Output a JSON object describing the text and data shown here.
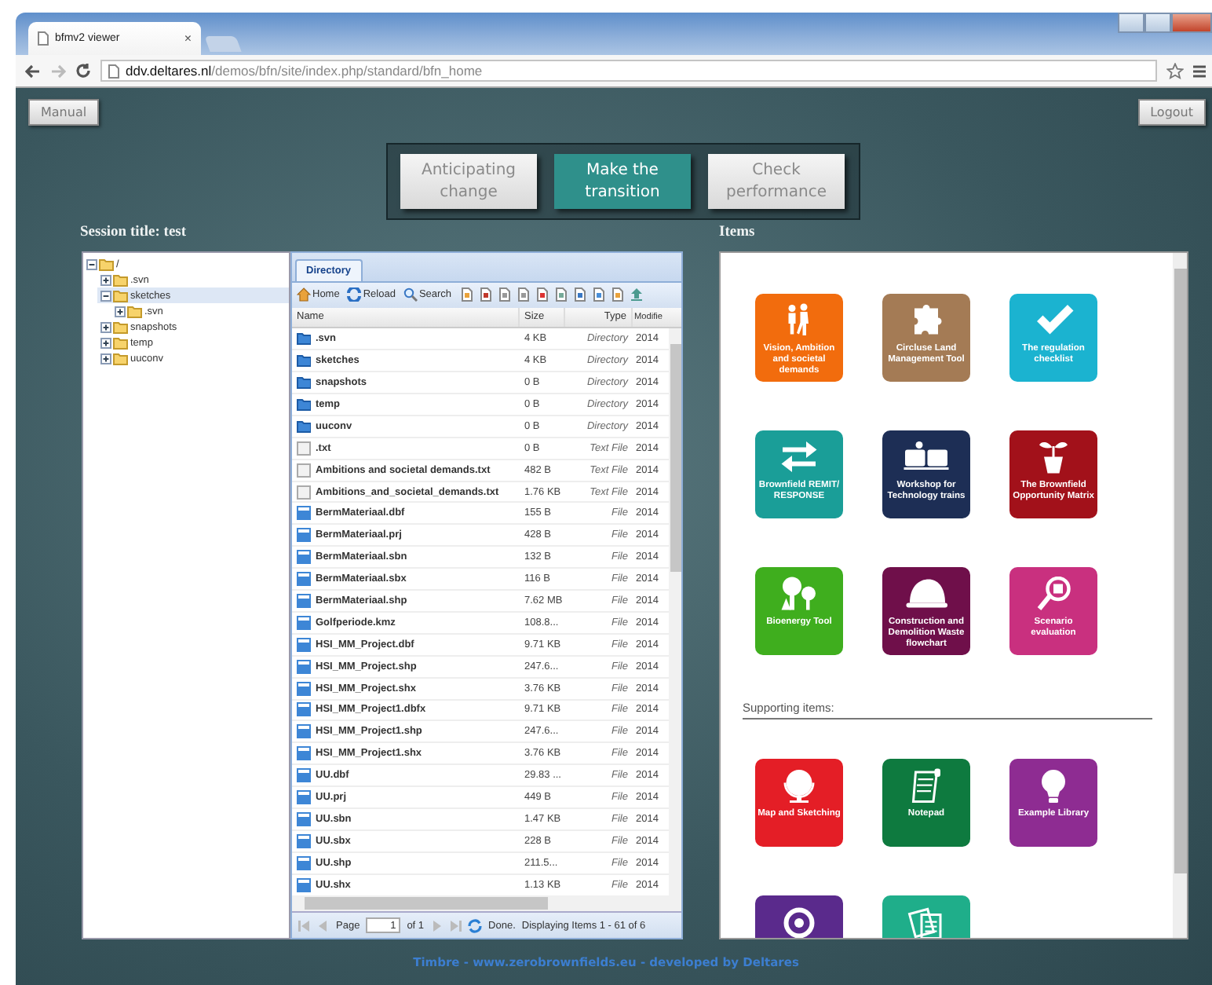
{
  "browser": {
    "tab_title": "bfmv2 viewer",
    "tab_close": "×",
    "url": "**ddv.deltares.nl**/demos/bfn/site/index.php/standard/bfn_home"
  },
  "top_buttons": [
    {
      "label": "Manual"
    },
    {
      "label": "Logout"
    }
  ],
  "stages": [
    {
      "label": "Anticipating change",
      "selected": false
    },
    {
      "label": "Make the transition",
      "selected": true
    },
    {
      "label": "Check performance",
      "selected": false
    }
  ],
  "session_title": "Session title: test",
  "items_title": "Items",
  "tree": [
    {
      "label": "/",
      "expanded": true,
      "selected": false,
      "children": [
        {
          "label": ".svn",
          "expanded": false,
          "selected": false
        },
        {
          "label": "sketches",
          "expanded": true,
          "selected": true,
          "children": [
            {
              "label": ".svn",
              "expanded": false,
              "selected": false
            }
          ]
        },
        {
          "label": "snapshots",
          "expanded": false,
          "selected": false
        },
        {
          "label": "temp",
          "expanded": false,
          "selected": false
        },
        {
          "label": "uuconv",
          "expanded": false,
          "selected": false
        }
      ]
    }
  ],
  "directory": {
    "tab": "Directory",
    "toolbar": [
      "Home",
      "Reload",
      "Search"
    ],
    "columns": [
      "Name",
      "Size",
      "Type",
      "Modifie"
    ],
    "rows": [
      {
        "kind": "directory",
        "name": ".svn",
        "size": "4 KB",
        "type": "Directory",
        "modified": "2014"
      },
      {
        "kind": "directory",
        "name": "sketches",
        "size": "4 KB",
        "type": "Directory",
        "modified": "2014"
      },
      {
        "kind": "directory",
        "name": "snapshots",
        "size": "0 B",
        "type": "Directory",
        "modified": "2014"
      },
      {
        "kind": "directory",
        "name": "temp",
        "size": "0 B",
        "type": "Directory",
        "modified": "2014"
      },
      {
        "kind": "directory",
        "name": "uuconv",
        "size": "0 B",
        "type": "Directory",
        "modified": "2014"
      },
      {
        "kind": "text",
        "name": ".txt",
        "size": "0 B",
        "type": "Text File",
        "modified": "2014"
      },
      {
        "kind": "text",
        "name": "Ambitions and societal demands.txt",
        "size": "482 B",
        "type": "Text File",
        "modified": "2014"
      },
      {
        "kind": "text",
        "name": "Ambitions_and_societal_demands.txt",
        "size": "1.76 KB",
        "type": "Text File",
        "modified": "2014"
      },
      {
        "kind": "file",
        "name": "BermMateriaal.dbf",
        "size": "155 B",
        "type": "File",
        "modified": "2014"
      },
      {
        "kind": "file",
        "name": "BermMateriaal.prj",
        "size": "428 B",
        "type": "File",
        "modified": "2014"
      },
      {
        "kind": "file",
        "name": "BermMateriaal.sbn",
        "size": "132 B",
        "type": "File",
        "modified": "2014"
      },
      {
        "kind": "file",
        "name": "BermMateriaal.sbx",
        "size": "116 B",
        "type": "File",
        "modified": "2014"
      },
      {
        "kind": "file",
        "name": "BermMateriaal.shp",
        "size": "7.62 MB",
        "type": "File",
        "modified": "2014"
      },
      {
        "kind": "file",
        "name": "Golfperiode.kmz",
        "size": "108.8...",
        "type": "File",
        "modified": "2014"
      },
      {
        "kind": "file",
        "name": "HSI_MM_Project.dbf",
        "size": "9.71 KB",
        "type": "File",
        "modified": "2014"
      },
      {
        "kind": "file",
        "name": "HSI_MM_Project.shp",
        "size": "247.6...",
        "type": "File",
        "modified": "2014"
      },
      {
        "kind": "file",
        "name": "HSI_MM_Project.shx",
        "size": "3.76 KB",
        "type": "File",
        "modified": "2014"
      },
      {
        "kind": "file",
        "name": "HSI_MM_Project1.dbfx",
        "size": "9.71 KB",
        "type": "File",
        "modified": "2014"
      },
      {
        "kind": "file",
        "name": "HSI_MM_Project1.shp",
        "size": "247.6...",
        "type": "File",
        "modified": "2014"
      },
      {
        "kind": "file",
        "name": "HSI_MM_Project1.shx",
        "size": "3.76 KB",
        "type": "File",
        "modified": "2014"
      },
      {
        "kind": "file",
        "name": "UU.dbf",
        "size": "29.83 ...",
        "type": "File",
        "modified": "2014"
      },
      {
        "kind": "file",
        "name": "UU.prj",
        "size": "449 B",
        "type": "File",
        "modified": "2014"
      },
      {
        "kind": "file",
        "name": "UU.sbn",
        "size": "1.47 KB",
        "type": "File",
        "modified": "2014"
      },
      {
        "kind": "file",
        "name": "UU.sbx",
        "size": "228 B",
        "type": "File",
        "modified": "2014"
      },
      {
        "kind": "file",
        "name": "UU.shp",
        "size": "211.5...",
        "type": "File",
        "modified": "2014"
      },
      {
        "kind": "file",
        "name": "UU.shx",
        "size": "1.13 KB",
        "type": "File",
        "modified": "2014"
      }
    ],
    "pager": {
      "page_label": "Page",
      "page": "1",
      "of": "of 1",
      "status": "Done.",
      "display": "Displaying Items 1 - 61 of 6"
    }
  },
  "items": [
    {
      "label": "Vision, Ambition and societal demands",
      "color": "#f26c0d"
    },
    {
      "label": "Circluse Land Management Tool",
      "color": "#a47b55"
    },
    {
      "label": "The regulation checklist",
      "color": "#1bb3d0"
    },
    {
      "label": "Brownfield REMIT/ RESPONSE",
      "color": "#1a9e98"
    },
    {
      "label": "Workshop for Technology trains",
      "color": "#1d2e55"
    },
    {
      "label": "The Brownfield Opportunity Matrix",
      "color": "#a2111a"
    },
    {
      "label": "Bioenergy Tool",
      "color": "#3fae1e"
    },
    {
      "label": "Construction and Demolition Waste flowchart",
      "color": "#6f0f4a"
    },
    {
      "label": "Scenario evaluation",
      "color": "#c9307f"
    }
  ],
  "supporting_title": "Supporting items:",
  "supporting_items": [
    {
      "label": "Map and Sketching",
      "color": "#e41e26"
    },
    {
      "label": "Notepad",
      "color": "#0e7a3f"
    },
    {
      "label": "Example Library",
      "color": "#8e2c92"
    },
    {
      "color": "#5a2a8c"
    },
    {
      "color": "#1fae8a"
    }
  ],
  "footer": "Timbre - www.zerobrownfields.eu - developed by Deltares"
}
